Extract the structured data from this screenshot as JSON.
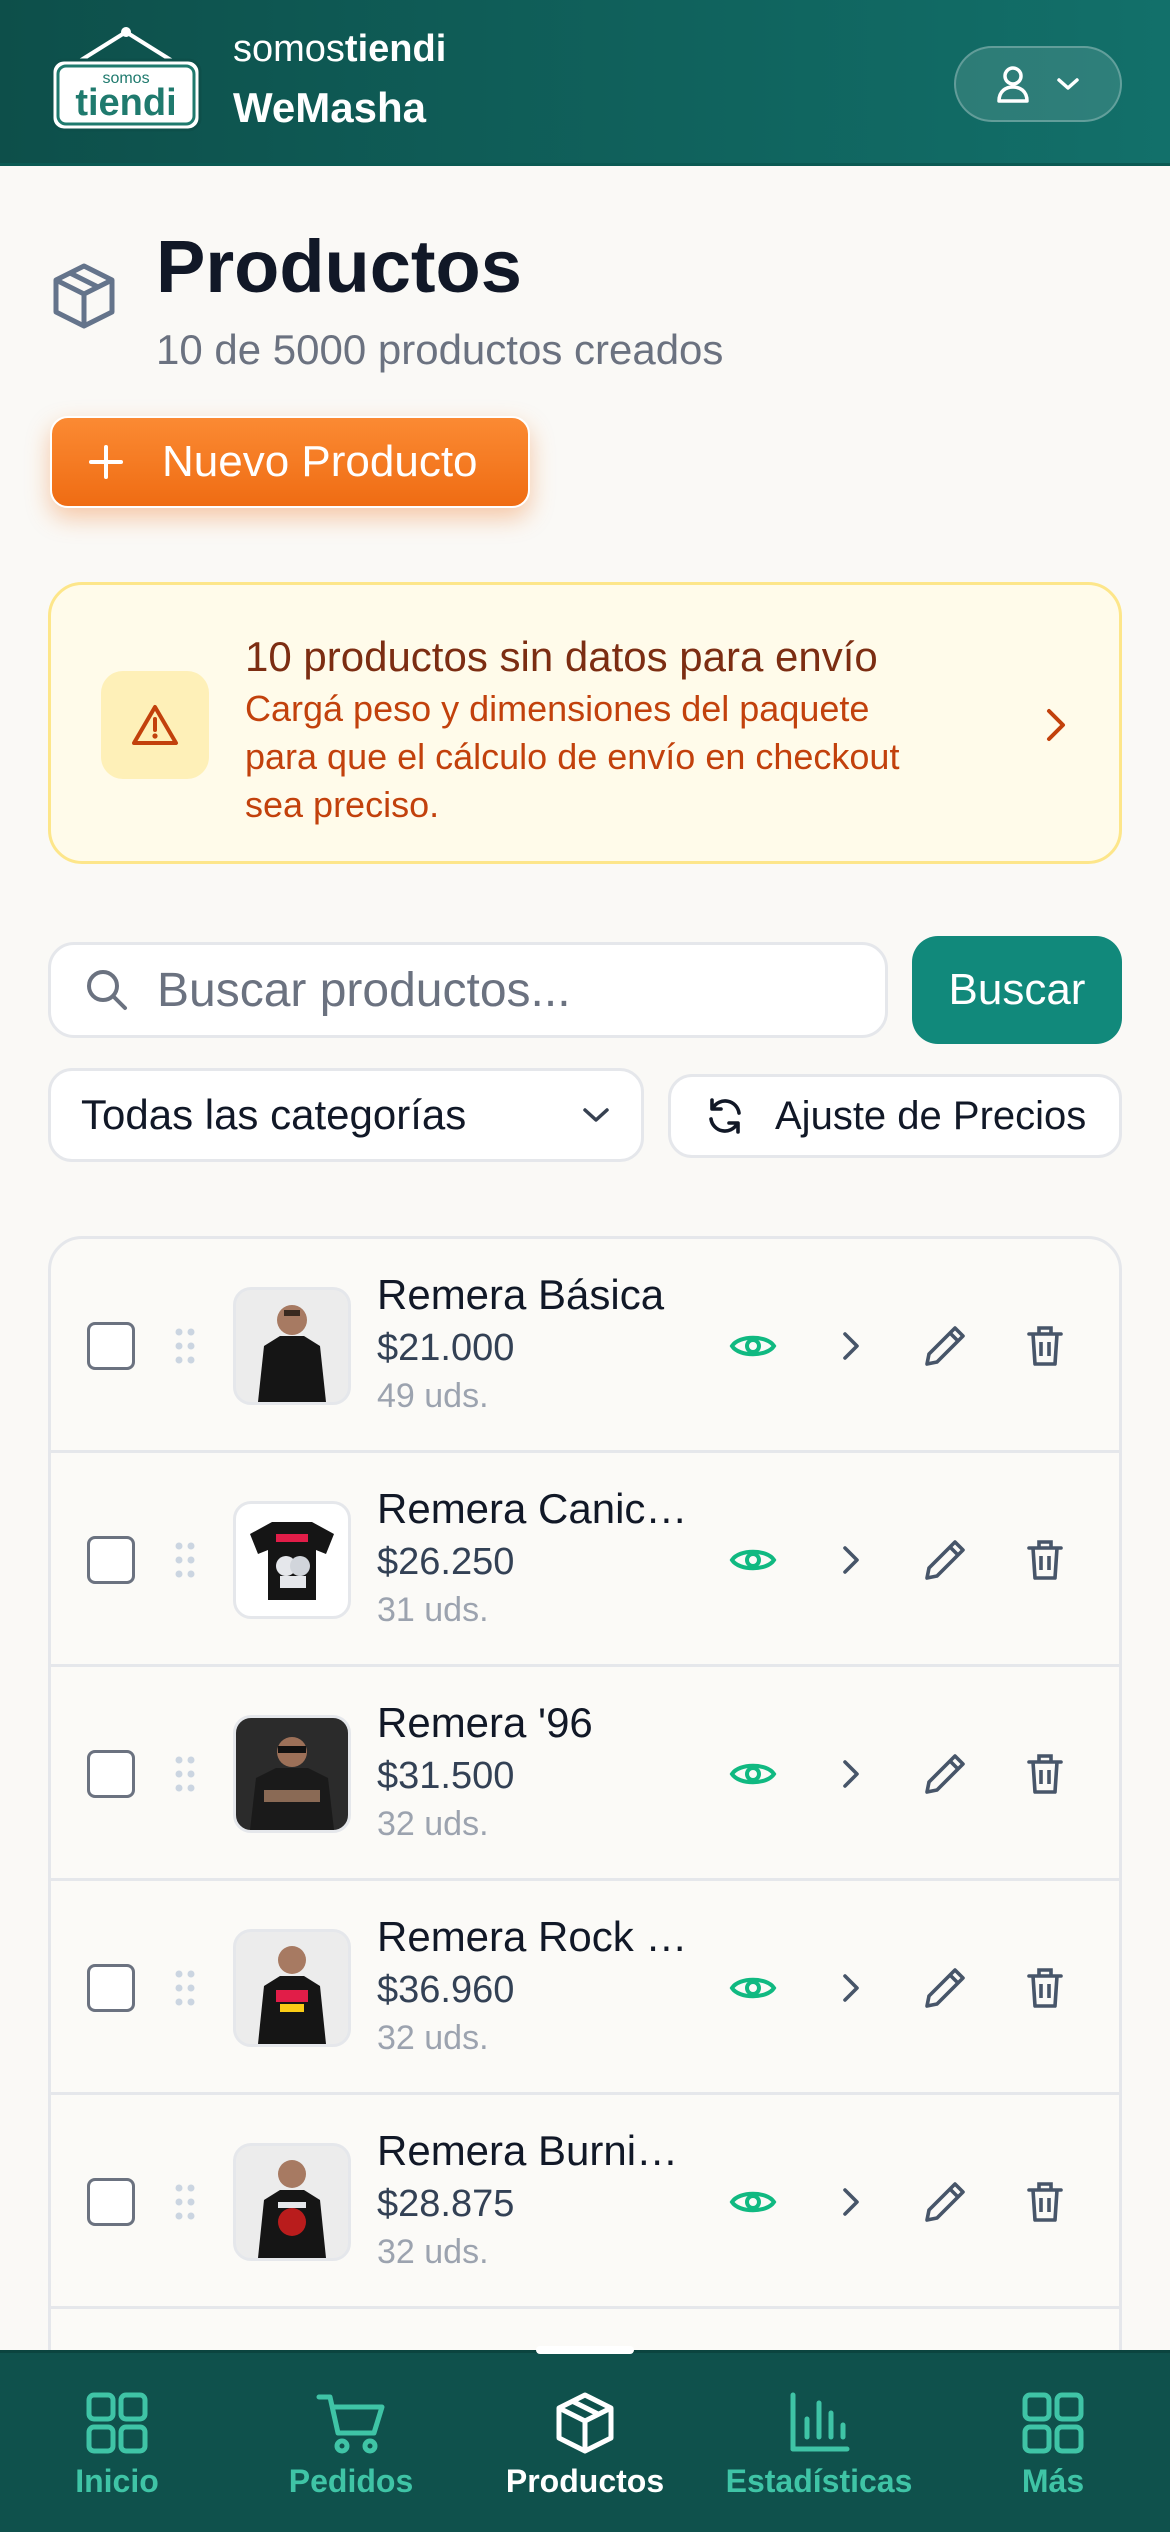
{
  "header": {
    "brand_prefix": "somos",
    "brand_name": "tiendi",
    "store_name": "WeMasha",
    "logo_small": "somos",
    "logo_big": "tiendi",
    "user_icon": "user-icon"
  },
  "page": {
    "title": "Productos",
    "subtitle": "10 de 5000 productos creados",
    "new_button": "Nuevo Producto"
  },
  "warning": {
    "title": "10 productos sin datos para envío",
    "text": "Cargá peso y dimensiones del paquete para que el cálculo de envío en checkout sea preciso."
  },
  "search": {
    "placeholder": "Buscar productos...",
    "button": "Buscar"
  },
  "filters": {
    "category_selected": "Todas las categorías",
    "price_button": "Ajuste de Precios"
  },
  "products": [
    {
      "name": "Remera Básica",
      "price": "$21.000",
      "stock": "49 uds."
    },
    {
      "name": "Remera Canic…",
      "price": "$26.250",
      "stock": "31 uds."
    },
    {
      "name": "Remera '96",
      "price": "$31.500",
      "stock": "32 uds."
    },
    {
      "name": "Remera Rock …",
      "price": "$36.960",
      "stock": "32 uds."
    },
    {
      "name": "Remera Burni…",
      "price": "$28.875",
      "stock": "32 uds."
    }
  ],
  "nav": [
    {
      "label": "Inicio",
      "icon": "grid-icon"
    },
    {
      "label": "Pedidos",
      "icon": "cart-icon"
    },
    {
      "label": "Productos",
      "icon": "box-icon",
      "active": true
    },
    {
      "label": "Estadísticas",
      "icon": "bar-chart-icon"
    },
    {
      "label": "Más",
      "icon": "grid-icon"
    }
  ],
  "colors": {
    "header": "#0d4f4a",
    "accent_orange": "#f97316",
    "teal": "#11897b",
    "eye_green": "#10b981"
  }
}
